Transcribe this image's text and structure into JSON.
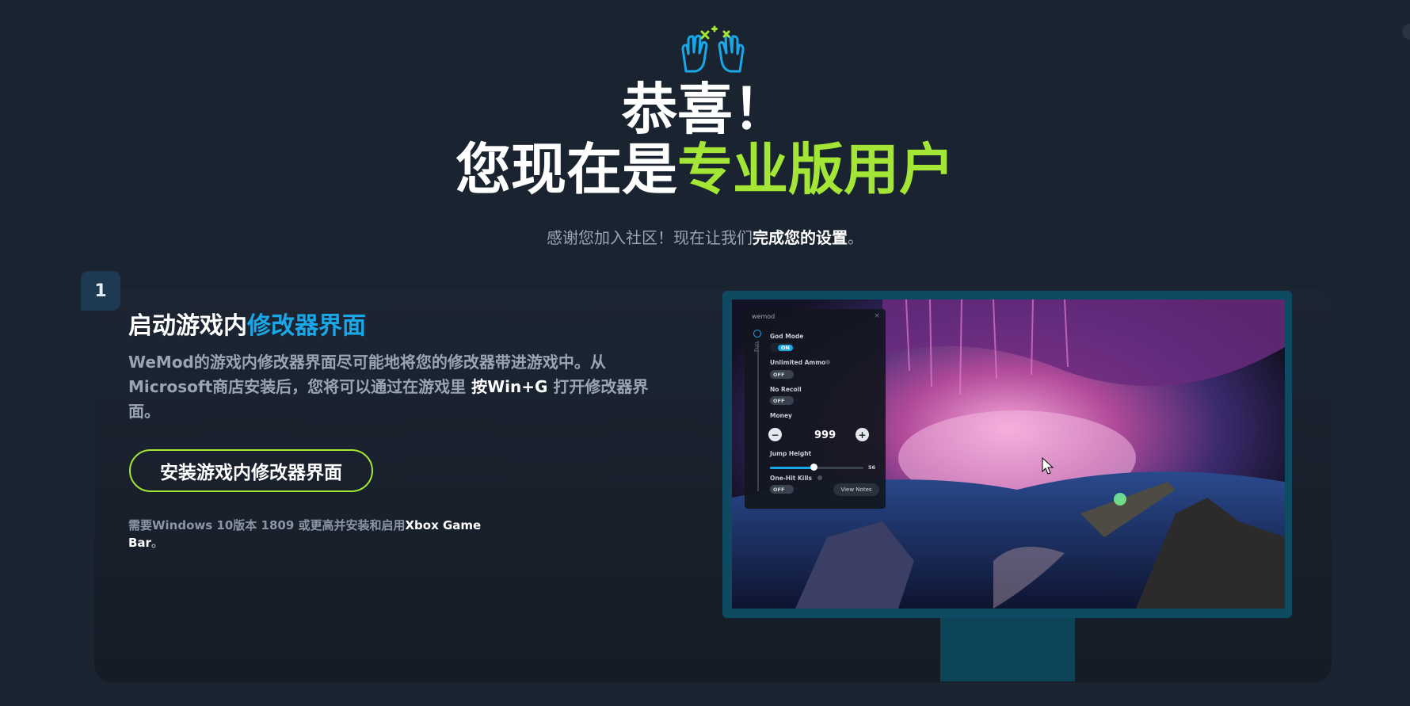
{
  "header": {
    "headline_line1": "恭喜！",
    "headline_line2_white": "您现在是",
    "headline_line2_accent": "专业版用户",
    "subline_plain": "感谢您加入社区！现在让我们",
    "subline_bold": "完成您的设置",
    "subline_end": "。"
  },
  "step": {
    "number": "1",
    "title_white": "启动游戏内",
    "title_blue": "修改器界面",
    "desc_part1": "WeMod的游戏内修改器界面尽可能地将您的修改器带进游戏中。从Microsoft商店安装后，您将可以通过在游戏里 ",
    "desc_bold": "按Win+G",
    "desc_part2": " 打开修改器界面。",
    "button_label": "安装游戏内修改器界面",
    "req_plain": "需要Windows 10版本 1809 或更高并安装和启用",
    "req_bold": "Xbox Game Bar",
    "req_end": "。"
  },
  "overlay": {
    "brand": "wemod",
    "close": "×",
    "rail_label": "Fun",
    "god_mode": "God Mode",
    "god_mode_state": "ON",
    "unlimited_ammo": "Unlimited Ammo",
    "unlimited_ammo_state": "OFF",
    "no_recoil": "No Recoil",
    "no_recoil_state": "OFF",
    "money": "Money",
    "money_value": "999",
    "jump_height": "Jump Height",
    "jump_height_value": "56",
    "jump_height_level": 0.47,
    "one_hit_kills": "One-Hit Kills",
    "one_hit_kills_state": "OFF",
    "view_notes": "View Notes"
  },
  "colors": {
    "accent_green": "#a3e635",
    "accent_blue": "#1aa7e8",
    "background": "#1a2330"
  }
}
